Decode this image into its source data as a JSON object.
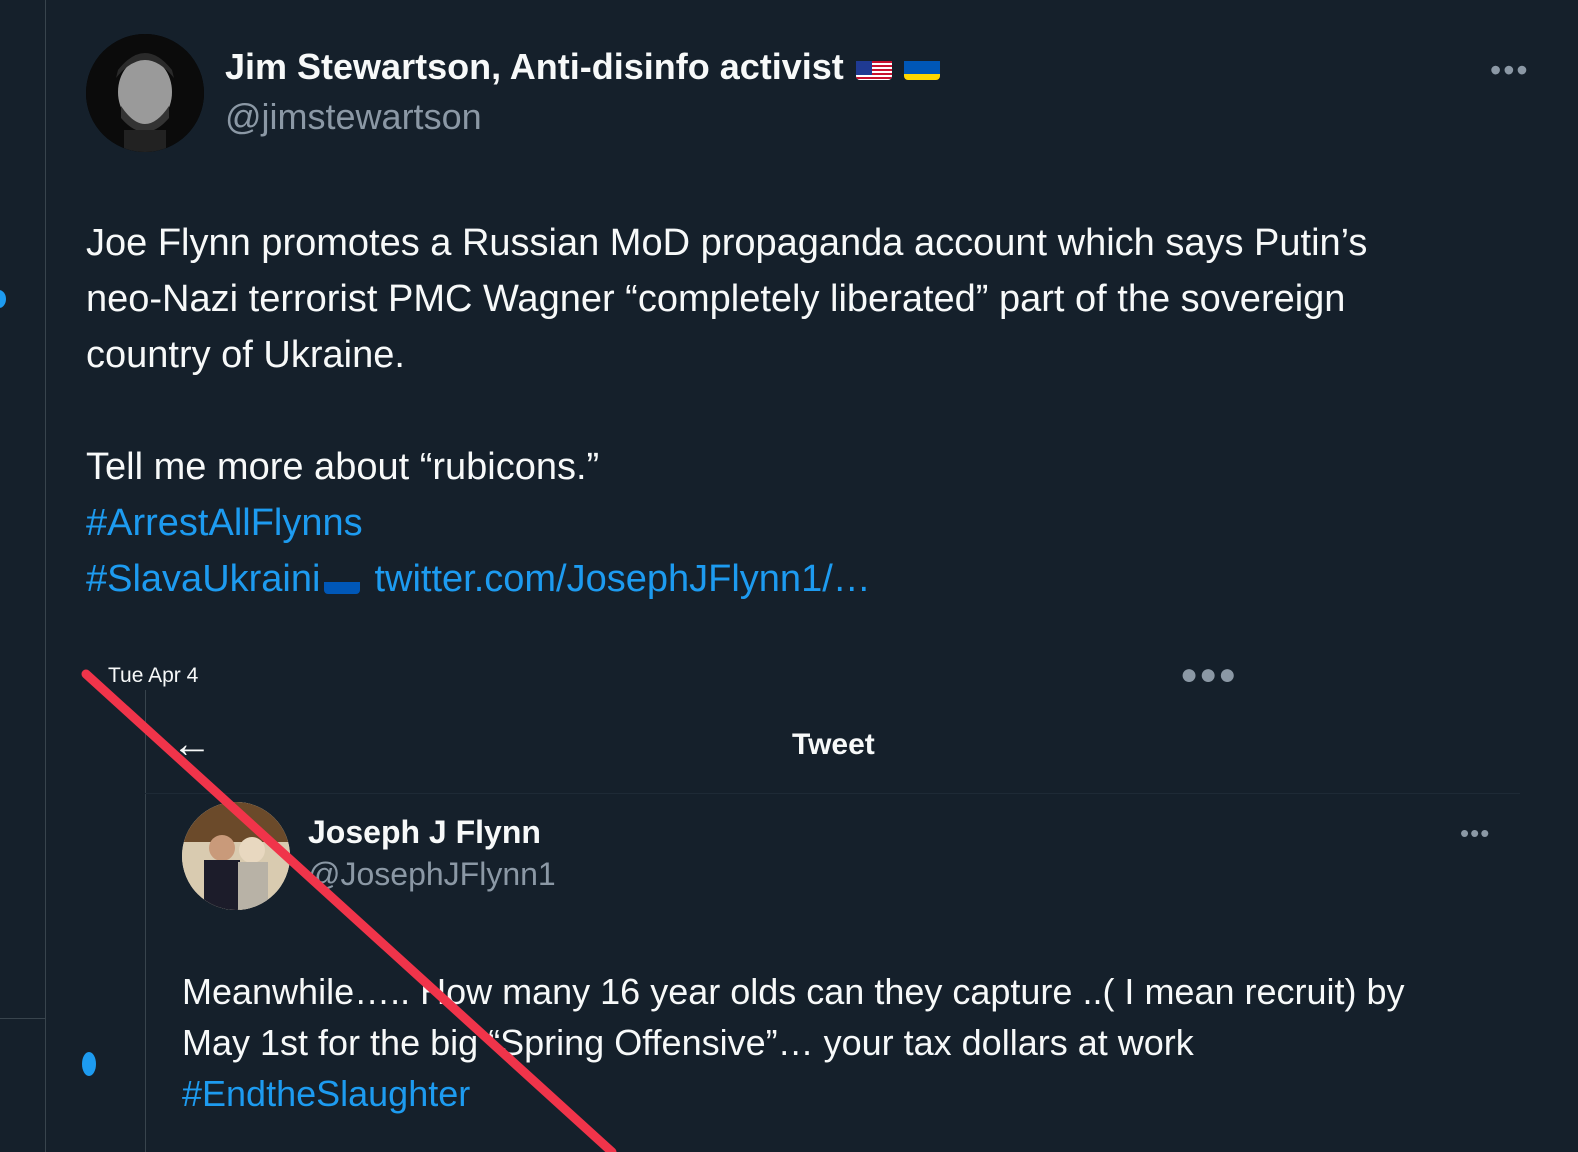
{
  "author": {
    "name": "Jim Stewartson, Anti-disinfo activist",
    "handle": "@jimstewartson"
  },
  "tweet": {
    "line1": "Joe Flynn promotes a Russian MoD propaganda account which says Putin’s",
    "line2": "neo-Nazi terrorist PMC Wagner “completely liberated” part of the sovereign",
    "line3": "country of Ukraine.",
    "line4": "Tell me more about “rubicons.”",
    "hashtag1": "#ArrestAllFlynns",
    "hashtag2": "#SlavaUkraini",
    "link": "twitter.com/JosephJFlynn1/…"
  },
  "quote": {
    "date": "Tue Apr 4",
    "header_title": "Tweet",
    "name": "Joseph J Flynn",
    "handle": "@JosephJFlynn1",
    "line1": "Meanwhile….. How many 16 year olds can they capture ..( I mean recruit) by",
    "line2": "May 1st for the big “Spring Offensive”… your tax dollars at work",
    "hashtag": "#EndtheSlaughter"
  },
  "icons": {
    "more": "more-options-icon",
    "back": "back-arrow-icon",
    "flag_us": "us-flag-icon",
    "flag_ua": "ukraine-flag-icon"
  },
  "colors": {
    "background": "#15202b",
    "link": "#1d9bf0",
    "secondary_text": "#8b98a5",
    "slash": "#f0344a"
  }
}
